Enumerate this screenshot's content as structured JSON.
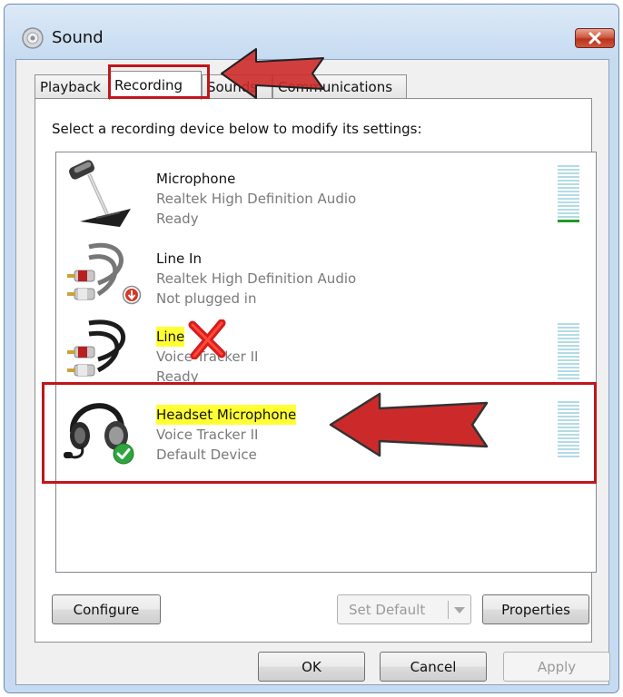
{
  "window": {
    "title": "Sound",
    "close_label": "✕"
  },
  "tabs": [
    {
      "label": "Playback",
      "active": false
    },
    {
      "label": "Recording",
      "active": true
    },
    {
      "label": "Sounds",
      "active": false
    },
    {
      "label": "Communications",
      "active": false
    }
  ],
  "panel": {
    "instruction": "Select a recording device below to modify its settings:"
  },
  "devices": [
    {
      "name": "Microphone",
      "driver": "Realtek High Definition Audio",
      "status": "Ready",
      "icon": "microphone-icon",
      "highlighted": false,
      "level_meter": true,
      "level": 0.05
    },
    {
      "name": "Line In",
      "driver": "Realtek High Definition Audio",
      "status": "Not plugged in",
      "icon": "line-in-cable-icon",
      "highlighted": false,
      "level_meter": false,
      "badge": "unplugged-arrow-icon"
    },
    {
      "name": "Line",
      "driver": "Voice Tracker II",
      "status": "Ready",
      "icon": "line-cable-icon",
      "highlighted": true,
      "level_meter": true,
      "level": 0,
      "annotation": "red-x-icon"
    },
    {
      "name": "Headset Microphone",
      "driver": "Voice Tracker II",
      "status": "Default Device",
      "icon": "headset-icon",
      "highlighted": true,
      "level_meter": true,
      "level": 0,
      "badge": "default-check-icon",
      "selected_frame": true
    }
  ],
  "buttons": {
    "configure": "Configure",
    "set_default": "Set Default",
    "properties": "Properties",
    "ok": "OK",
    "cancel": "Cancel",
    "apply": "Apply"
  },
  "colors": {
    "annotation_red": "#c0161b",
    "arrow_fill": "#cc2a2a",
    "highlight_yellow": "#ffff33",
    "meter_idle": "#b3dbe6",
    "meter_active": "#1e9a2a"
  }
}
